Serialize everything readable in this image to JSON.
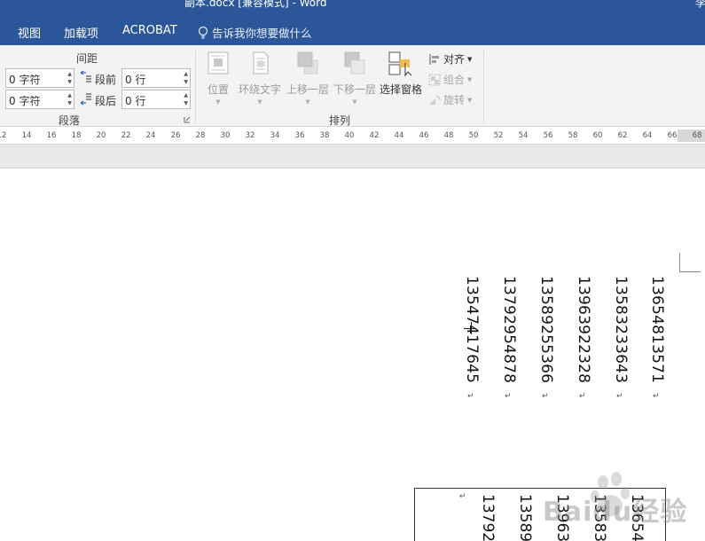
{
  "titlebar": {
    "title": "副本.docx [兼容模式] - Word",
    "corner": "李"
  },
  "menu": {
    "tabs": [
      "视图",
      "加载项",
      "ACROBAT"
    ],
    "tell_me": "告诉我你想要做什么"
  },
  "ribbon": {
    "spacing": {
      "header": "间距",
      "before_label": "段前",
      "after_label": "段后",
      "left_value_1": "0 字符",
      "left_value_2": "0 字符",
      "before_value": "0 行",
      "after_value": "0 行",
      "group_label": "段落"
    },
    "arrange": {
      "position": "位置",
      "wrap_text": "环绕文字",
      "bring_forward": "上移一层",
      "send_backward": "下移一层",
      "selection_pane": "选择窗格",
      "align": "对齐",
      "group": "组合",
      "rotate": "旋转",
      "group_label": "排列"
    }
  },
  "ruler": {
    "ticks": [
      "12",
      "14",
      "16",
      "18",
      "20",
      "22",
      "24",
      "26",
      "28",
      "30",
      "32",
      "34",
      "36",
      "38",
      "40",
      "42",
      "44",
      "46",
      "48",
      "50",
      "52",
      "54",
      "56",
      "58",
      "60",
      "62",
      "64",
      "66",
      "68"
    ]
  },
  "document": {
    "columns": [
      "13547417645",
      "13792954878",
      "13589255366",
      "13963922328",
      "13583233643",
      "13654813571"
    ],
    "return_mark": "↵",
    "textbox_columns": [
      "13792",
      "13589",
      "13963",
      "13583",
      "13654"
    ]
  },
  "watermark": {
    "text": "Baidu经验"
  },
  "colors": {
    "ribbon_blue": "#2b579a",
    "ribbon_bg": "#f3f3f3"
  }
}
